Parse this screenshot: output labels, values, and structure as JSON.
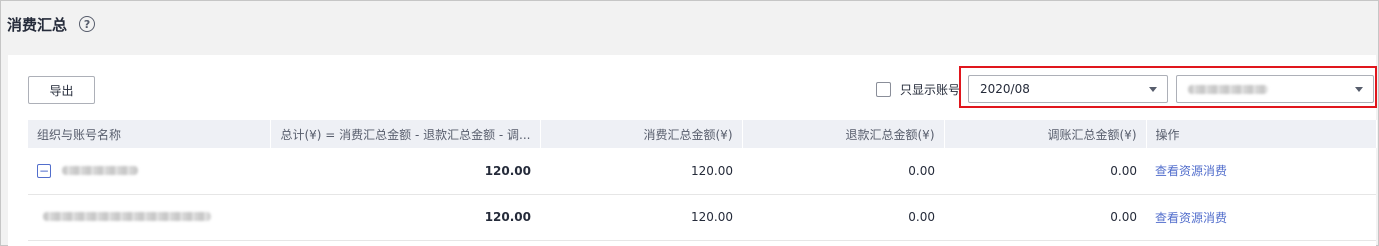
{
  "page": {
    "title": "消费汇总",
    "help_icon": "help-circle-icon"
  },
  "toolbar": {
    "export_label": "导出",
    "only_accounts_label": "只显示账号",
    "only_accounts_checked": false,
    "month_value": "2020/08",
    "account_value": ""
  },
  "table": {
    "headers": [
      "组织与账号名称",
      "总计(¥) = 消费汇总金额 - 退款汇总金额 - 调...",
      "消费汇总金额(¥)",
      "退款汇总金额(¥)",
      "调账汇总金额(¥)",
      "操作"
    ],
    "rows": [
      {
        "name": "",
        "total": "120.00",
        "consume": "120.00",
        "refund": "0.00",
        "adjust": "0.00",
        "action": "查看资源消费"
      },
      {
        "name": "",
        "total": "120.00",
        "consume": "120.00",
        "refund": "0.00",
        "adjust": "0.00",
        "action": "查看资源消费"
      }
    ]
  },
  "colors": {
    "highlight": "#e0161d",
    "link": "#526ecc",
    "header_bg": "#eef0f5"
  }
}
